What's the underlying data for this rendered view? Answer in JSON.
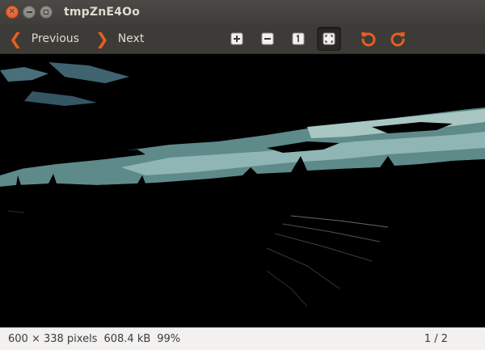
{
  "window": {
    "title": "tmpZnE4Oo",
    "controls": {
      "close_glyph": "✕",
      "minimize_glyph": "—",
      "maximize_glyph": "▢"
    }
  },
  "toolbar": {
    "previous_label": "Previous",
    "next_label": "Next",
    "tools": [
      {
        "name": "zoom-in-icon",
        "active": false
      },
      {
        "name": "zoom-out-icon",
        "active": false
      },
      {
        "name": "normal-size-icon",
        "active": false
      },
      {
        "name": "best-fit-icon",
        "active": true
      },
      {
        "name": "rotate-left-icon",
        "active": false
      },
      {
        "name": "rotate-right-icon",
        "active": false
      }
    ],
    "accent_color": "#e95d20"
  },
  "status": {
    "dimensions": "600 × 338 pixels",
    "file_size": "608.4 kB",
    "zoom": "99%",
    "page": "1 / 2"
  }
}
